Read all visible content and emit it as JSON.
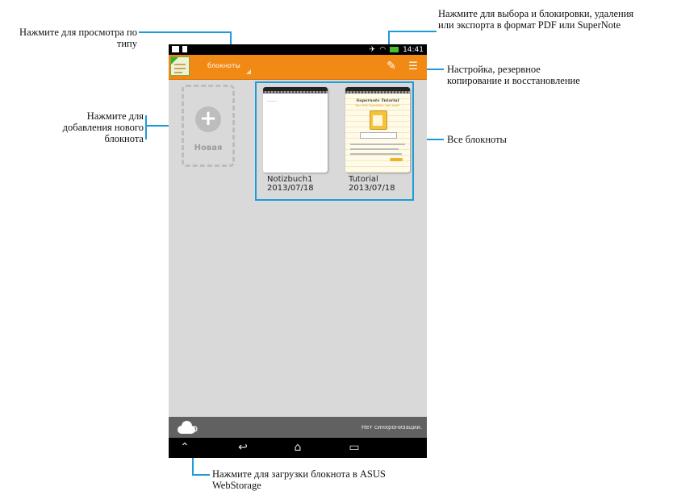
{
  "callouts": {
    "view_type": [
      "Нажмите для просмотра по",
      "типу"
    ],
    "select": [
      "Нажмите для выбора и блокировки, удаления",
      "или экспорта в формат PDF или SuperNote"
    ],
    "settings": [
      "Настройка, резервное",
      "копирование и восстановление"
    ],
    "add_new": [
      "Нажмите для",
      "добавления нового",
      "блокнота"
    ],
    "all_notebooks": [
      "Все блокноты"
    ],
    "upload": [
      "Нажмите для загрузки блокнота в ASUS",
      "WebStorage"
    ]
  },
  "status_bar": {
    "time": "14:41"
  },
  "action_bar": {
    "view_type_label": "блокноты"
  },
  "new_notebook": {
    "label": "Новая"
  },
  "notebooks": [
    {
      "name": "Notizbuch1",
      "date": "2013/07/18"
    },
    {
      "name": "Tutorial",
      "date": "2013/07/18"
    }
  ],
  "tutorial_cover": {
    "title": "Supernote Tutorial",
    "subtitle": "Your first SuperNote note book!"
  },
  "bottom_bar": {
    "sync_status": "Нет синхронизации."
  },
  "colors": {
    "accent": "#1e9cd7",
    "action_bar": "#f08a14"
  }
}
